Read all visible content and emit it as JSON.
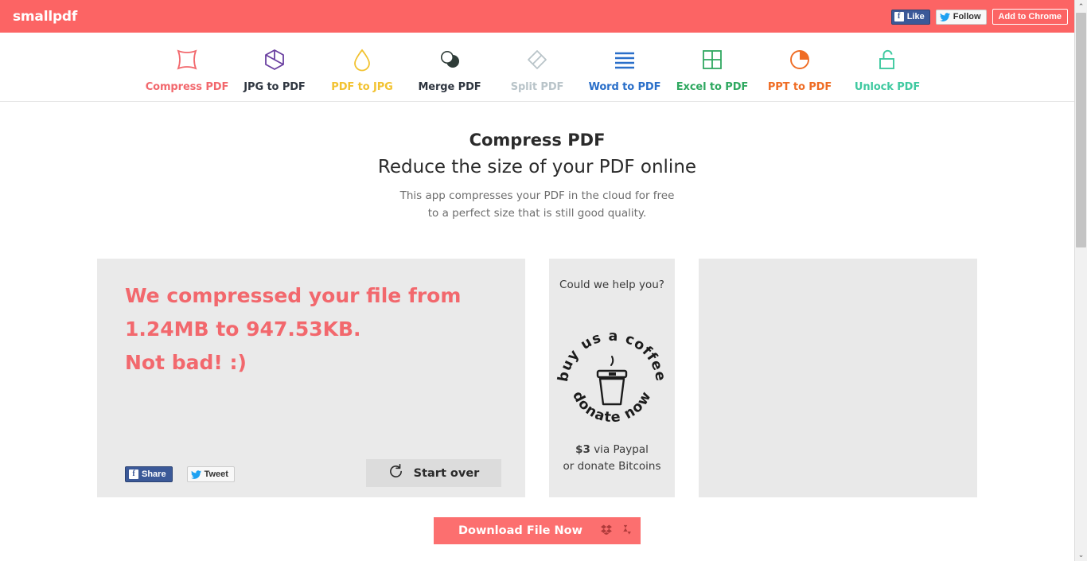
{
  "topbar": {
    "brand": "smallpdf",
    "facebook_like": "Like",
    "twitter_follow": "Follow",
    "add_to_chrome": "Add to Chrome",
    "background_color": "#fc6464"
  },
  "nav": {
    "items": [
      {
        "label": "Compress PDF",
        "icon": "compress-square-icon",
        "color": "#f2686d",
        "active": true
      },
      {
        "label": "JPG to PDF",
        "icon": "cube-icon",
        "color": "#6a3fa0"
      },
      {
        "label": "PDF to JPG",
        "icon": "droplet-icon",
        "color": "#f2c230"
      },
      {
        "label": "Merge PDF",
        "icon": "two-circles-icon",
        "color": "#2f3c38"
      },
      {
        "label": "Split PDF",
        "icon": "diamond-slash-icon",
        "color": "#b9c4c9"
      },
      {
        "label": "Word to PDF",
        "icon": "lines-icon",
        "color": "#2a6fc9"
      },
      {
        "label": "Excel to PDF",
        "icon": "grid-icon",
        "color": "#2fa860"
      },
      {
        "label": "PPT to PDF",
        "icon": "pie-icon",
        "color": "#ef6c24"
      },
      {
        "label": "Unlock PDF",
        "icon": "open-padlock-icon",
        "color": "#3fc9a0"
      }
    ]
  },
  "hero": {
    "title": "Compress PDF",
    "subtitle": "Reduce the size of your PDF online",
    "description": "This app compresses your PDF in the cloud for free to a perfect size that is still good quality."
  },
  "result": {
    "line1": "We compressed your file from",
    "line2": "1.24MB to 947.53KB.",
    "line3": "Not bad! :)",
    "original_size": "1.24MB",
    "compressed_size": "947.53KB",
    "text_color": "#f2686d",
    "facebook_share": "Share",
    "twitter_tweet": "Tweet",
    "start_over": "Start over"
  },
  "donate": {
    "question": "Could we help you?",
    "badge_top": "buy us a coffee",
    "badge_bottom": "donate now",
    "amount": "$3",
    "via": " via Paypal",
    "bitcoin_line": "or donate Bitcoins"
  },
  "download": {
    "label": "Download File Now",
    "dropbox_icon": "dropbox-icon",
    "gdrive_icon": "google-drive-icon",
    "background_color": "#fc6f6f"
  },
  "scrollbar": {
    "up_arrow": "⌃",
    "down_arrow": "⌄"
  }
}
